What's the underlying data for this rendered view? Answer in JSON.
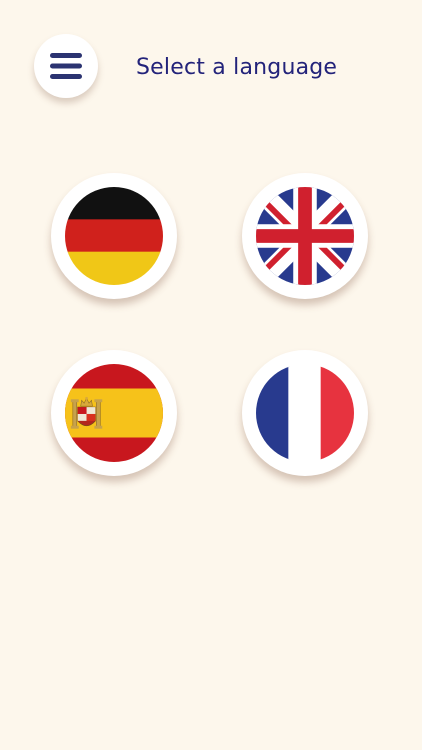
{
  "header": {
    "title": "Select a language",
    "menu_icon": "hamburger-menu-icon"
  },
  "colors": {
    "background": "#fdf7ec",
    "title": "#23237a",
    "menu_icon": "#2b3371"
  },
  "languages": [
    {
      "code": "de",
      "flag_icon": "germany-flag-icon"
    },
    {
      "code": "en",
      "flag_icon": "united-kingdom-flag-icon"
    },
    {
      "code": "es",
      "flag_icon": "spain-flag-icon"
    },
    {
      "code": "fr",
      "flag_icon": "france-flag-icon"
    }
  ]
}
